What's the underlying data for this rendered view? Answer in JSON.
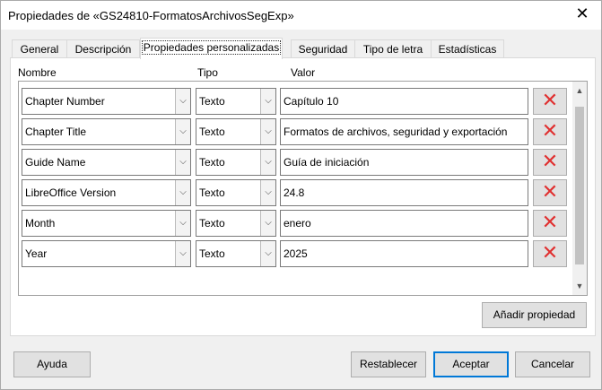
{
  "window": {
    "title": "Propiedades de «GS24810-FormatosArchivosSegExp»",
    "close_glyph": "✕"
  },
  "tabs": [
    {
      "label": "General"
    },
    {
      "label": "Descripción"
    },
    {
      "label": "Propiedades personalizadas"
    },
    {
      "label": "Seguridad"
    },
    {
      "label": "Tipo de letra"
    },
    {
      "label": "Estadísticas"
    }
  ],
  "active_tab": "Propiedades personalizadas",
  "columns": {
    "name": "Nombre",
    "type": "Tipo",
    "value": "Valor"
  },
  "properties": [
    {
      "name": "Chapter Number",
      "type": "Texto",
      "value": "Capítulo 10"
    },
    {
      "name": "Chapter Title",
      "type": "Texto",
      "value": "Formatos de archivos, seguridad y exportación"
    },
    {
      "name": "Guide Name",
      "type": "Texto",
      "value": "Guía de iniciación"
    },
    {
      "name": "LibreOffice Version",
      "type": "Texto",
      "value": "24.8"
    },
    {
      "name": "Month",
      "type": "Texto",
      "value": "enero"
    },
    {
      "name": "Year",
      "type": "Texto",
      "value": "2025"
    }
  ],
  "add_button": "Añadir propiedad",
  "footer": {
    "help": "Ayuda",
    "reset": "Restablecer",
    "ok": "Aceptar",
    "cancel": "Cancelar"
  },
  "colors": {
    "delete_icon": "#e03030",
    "primary_border": "#0078d7"
  }
}
